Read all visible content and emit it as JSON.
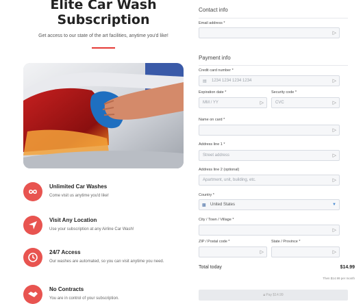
{
  "header": {
    "title_line1": "Elite Car Wash",
    "title_line2": "Subscription",
    "subtitle": "Get access to our state of the art facilities, anytime you'd like!"
  },
  "features": [
    {
      "icon": "infinity-icon",
      "title": "Unlimited Car Washes",
      "desc": "Come visit us anytime you'd like!"
    },
    {
      "icon": "location-arrow-icon",
      "title": "Visit Any Location",
      "desc": "Use your subscription at any Airline Car Wash!"
    },
    {
      "icon": "clock-icon",
      "title": "24/7 Access",
      "desc": "Our washes are automated, so you can visit anytime you need."
    },
    {
      "icon": "handshake-icon",
      "title": "No Contracts",
      "desc": "You are in control of your subscription."
    }
  ],
  "form": {
    "contact_heading": "Contact info",
    "email_label": "Email address *",
    "payment_heading": "Payment info",
    "card_label": "Credit card number *",
    "card_placeholder": "1234 1234 1234 1234",
    "expiry_label": "Expiration date *",
    "expiry_placeholder": "MM / YY",
    "cvc_label": "Security code *",
    "cvc_placeholder": "CVC",
    "name_label": "Name on card *",
    "addr1_label": "Address line 1 *",
    "addr1_placeholder": "Street address",
    "addr2_label": "Address line 2 (optional)",
    "addr2_placeholder": "Apartment, unit, building, etc.",
    "country_label": "Country *",
    "country_value": "United States",
    "city_label": "City / Town / Village *",
    "zip_label": "ZIP / Postal code *",
    "state_label": "State / Province *",
    "total_label": "Total today",
    "total_value": "$14.99",
    "then_text": "Then $14.99 per month",
    "pay_label": "Pay $14.99"
  },
  "colors": {
    "accent": "#e85450"
  }
}
